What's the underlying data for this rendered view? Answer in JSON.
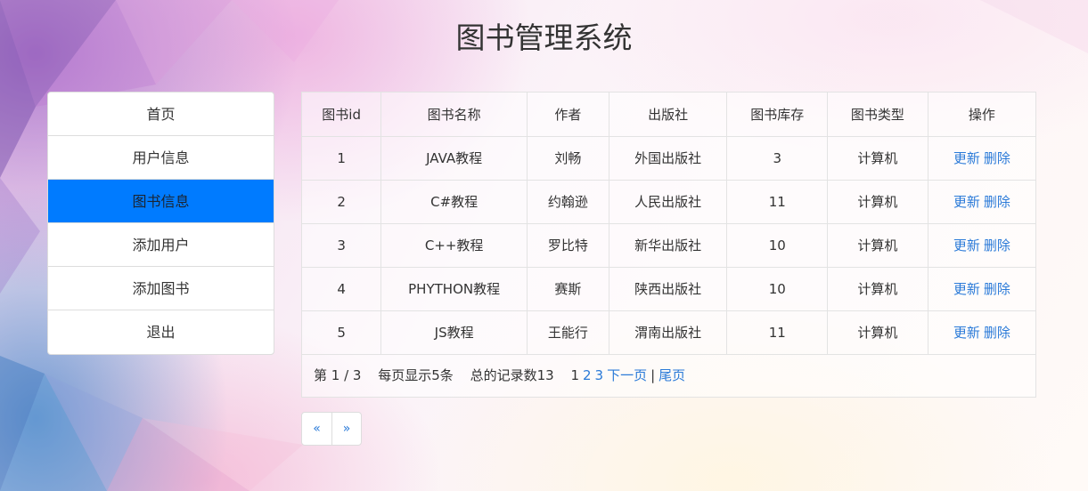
{
  "title": "图书管理系统",
  "sidebar": {
    "items": [
      {
        "label": "首页"
      },
      {
        "label": "用户信息"
      },
      {
        "label": "图书信息",
        "active": true
      },
      {
        "label": "添加用户"
      },
      {
        "label": "添加图书"
      },
      {
        "label": "退出"
      }
    ]
  },
  "table": {
    "headers": [
      "图书id",
      "图书名称",
      "作者",
      "出版社",
      "图书库存",
      "图书类型",
      "操作"
    ],
    "rows": [
      {
        "id": "1",
        "name": "JAVA教程",
        "author": "刘畅",
        "publisher": "外国出版社",
        "stock": "3",
        "type": "计算机"
      },
      {
        "id": "2",
        "name": "C#教程",
        "author": "约翰逊",
        "publisher": "人民出版社",
        "stock": "11",
        "type": "计算机"
      },
      {
        "id": "3",
        "name": "C++教程",
        "author": "罗比特",
        "publisher": "新华出版社",
        "stock": "10",
        "type": "计算机"
      },
      {
        "id": "4",
        "name": "PHYTHON教程",
        "author": "赛斯",
        "publisher": "陕西出版社",
        "stock": "10",
        "type": "计算机"
      },
      {
        "id": "5",
        "name": "JS教程",
        "author": "王能行",
        "publisher": "渭南出版社",
        "stock": "11",
        "type": "计算机"
      }
    ],
    "actions": {
      "update": "更新",
      "delete": "删除"
    }
  },
  "pagination": {
    "page_info": "第 1 / 3",
    "per_page": "每页显示5条",
    "total": "总的记录数13",
    "current": "1",
    "pages": [
      "2",
      "3"
    ],
    "next": "下一页",
    "separator": "|",
    "last": "尾页",
    "prev_arrow": "«",
    "next_arrow": "»"
  },
  "colors": {
    "active_nav": "#007bff",
    "link": "#2a7ad8"
  }
}
